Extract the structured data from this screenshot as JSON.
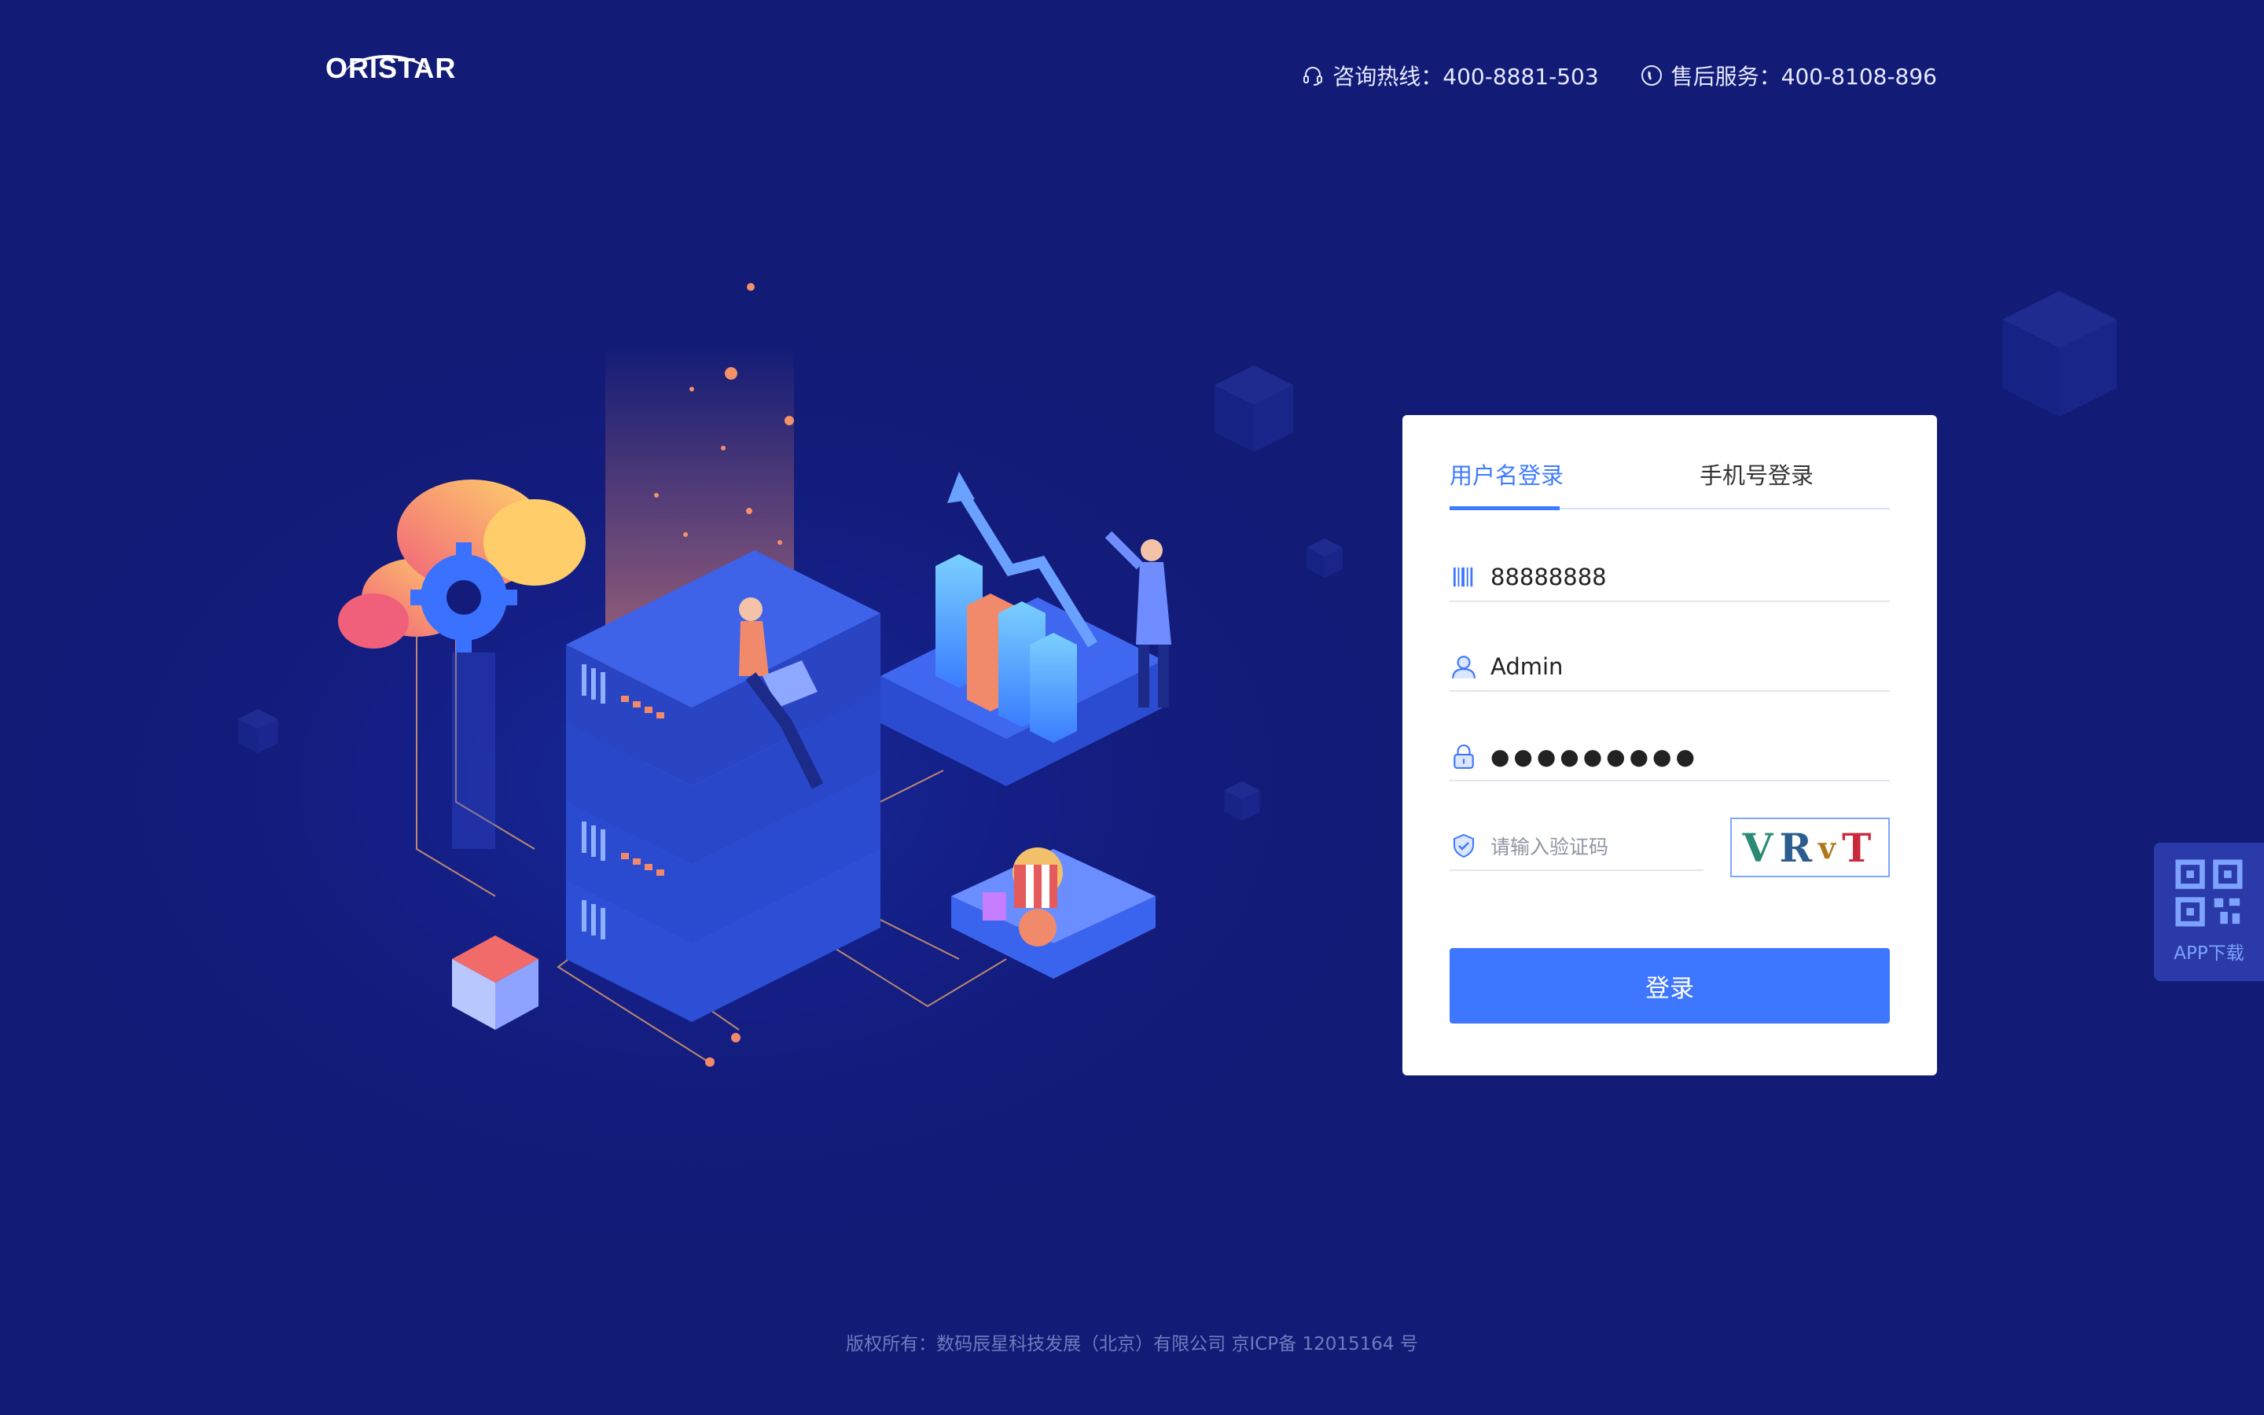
{
  "header": {
    "logo_text": "ORISTAR",
    "consult_label": "咨询热线：400-8881-503",
    "service_label": "售后服务：400-8108-896",
    "consult_icon": "headset-icon",
    "service_icon": "phone-icon"
  },
  "login": {
    "tabs": [
      {
        "label": "用户名登录",
        "active": true
      },
      {
        "label": "手机号登录",
        "active": false
      }
    ],
    "company_code": "88888888",
    "username": "Admin",
    "password_mask": "●●●●●●●●●",
    "captcha_placeholder": "请输入验证码",
    "captcha_chars": [
      "V",
      "R",
      "v",
      "T"
    ],
    "submit_label": "登录"
  },
  "sidebar": {
    "app_download_label": "APP下载",
    "app_download_icon": "qr-code-icon"
  },
  "footer": {
    "copyright": "版权所有：数码辰星科技发展（北京）有限公司 京ICP备 12015164 号"
  },
  "colors": {
    "background": "#131c7a",
    "accent": "#3d76ff",
    "card": "#ffffff"
  }
}
